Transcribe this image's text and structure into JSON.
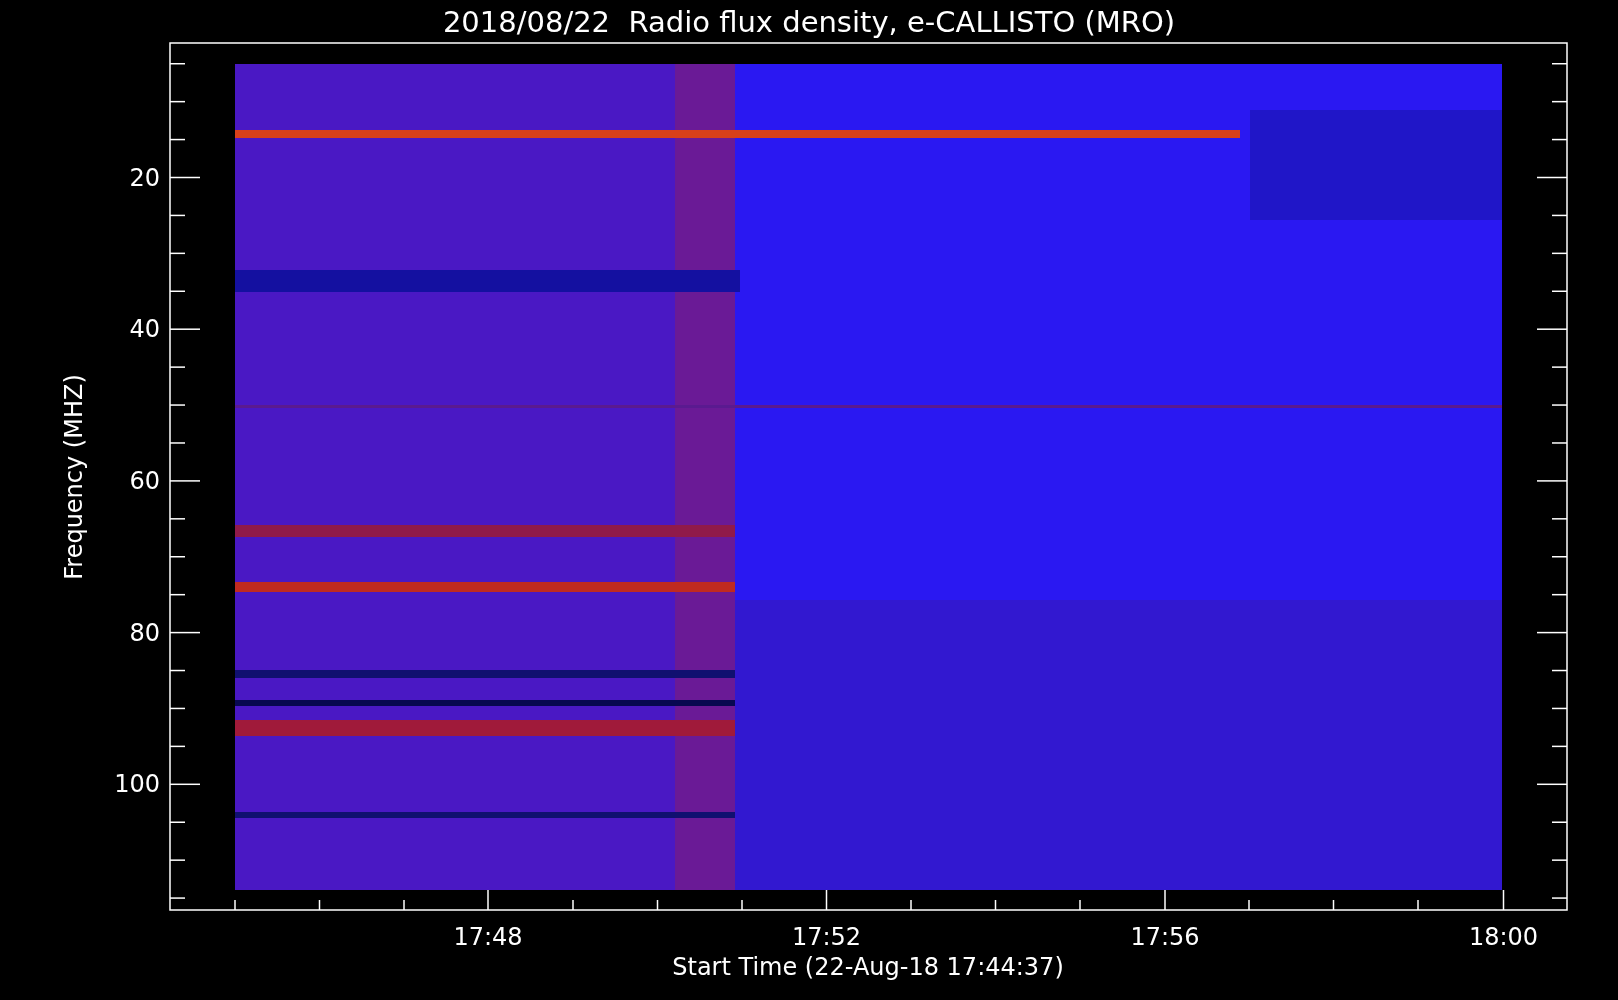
{
  "title": "2018/08/22  Radio flux density, e-CALLISTO (MRO)",
  "y_axis": {
    "label": "Frequency (MHZ)",
    "ticks": [
      "20",
      "40",
      "60",
      "80",
      "100"
    ]
  },
  "x_axis": {
    "label": "Start Time (22-Aug-18 17:44:37)",
    "ticks": [
      "17:48",
      "17:52",
      "17:56",
      "18:00"
    ]
  }
}
